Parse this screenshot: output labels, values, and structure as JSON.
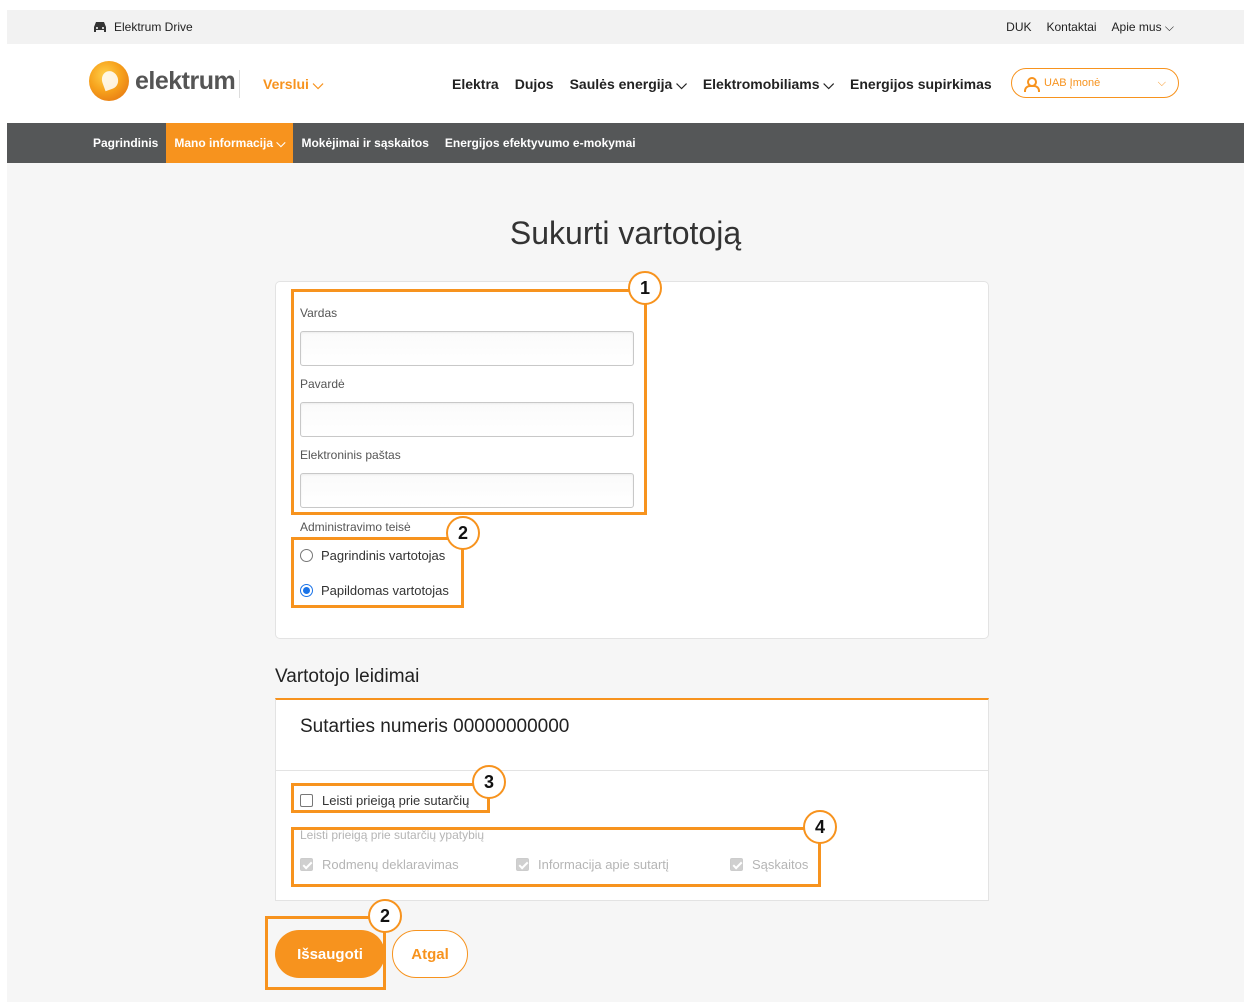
{
  "util_bar": {
    "brand": "Elektrum Drive",
    "links": [
      "DUK",
      "Kontaktai",
      "Apie mus ⌵"
    ]
  },
  "header": {
    "logo_text": "elektrum",
    "segment": "Verslui ⌵",
    "nav": [
      "Elektra",
      "Dujos",
      "Saulės energija ⌵",
      "Elektromobiliams ⌵",
      "Energijos supirkimas"
    ],
    "account": "UAB Įmonė"
  },
  "sub_nav": {
    "items": [
      "Pagrindinis",
      "Mano informacija ⌵",
      "Mokėjimai ir sąskaitos",
      "Energijos efektyvumo e-mokymai"
    ],
    "active_index": 1
  },
  "page_title": "Sukurti vartotoją",
  "form": {
    "first_name_label": "Vardas",
    "first_name_value": "",
    "last_name_label": "Pavardė",
    "last_name_value": "",
    "email_label": "Elektroninis paštas",
    "email_value": "",
    "rights_label": "Administravimo teisė",
    "radio_main": "Pagrindinis vartotojas",
    "radio_extra": "Papildomas vartotojas",
    "selected": "Papildomas vartotojas"
  },
  "permissions": {
    "heading": "Vartotojo leidimai",
    "contract_title": "Sutarties numeris",
    "contract_number": "00000000000",
    "allow_access": "Leisti prieigą prie sutarčių",
    "allow_access_checked": false,
    "features_label": "Leisti prieigą prie sutarčių ypatybių",
    "features": [
      "Rodmenų deklaravimas",
      "Informacija apie sutartį",
      "Sąskaitos"
    ]
  },
  "buttons": {
    "save": "Išsaugoti",
    "back": "Atgal"
  },
  "annotations": [
    "1",
    "2",
    "3",
    "4",
    "2"
  ],
  "colors": {
    "accent": "#f7931e",
    "subnav_bg": "#555758",
    "radio_selected": "#1a73e8"
  }
}
